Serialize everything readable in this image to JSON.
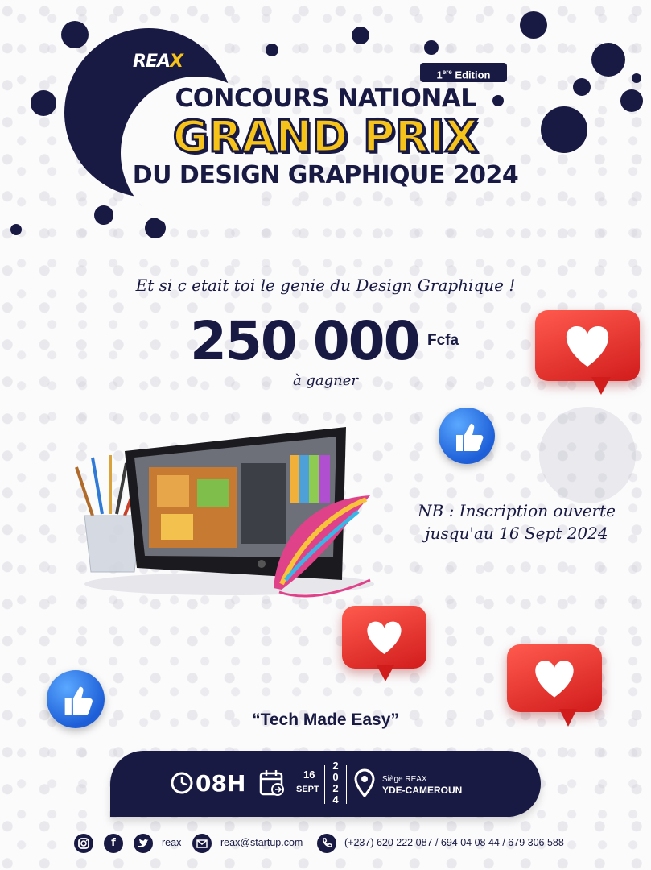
{
  "brand": {
    "logo_text": "REA",
    "logo_x": "X"
  },
  "header": {
    "edition_num": "1",
    "edition_sup": "ere",
    "edition_label": "Edition",
    "title_line1": "CONCOURS NATIONAL",
    "title_line2": "GRAND PRIX",
    "title_line3": "DU DESIGN GRAPHIQUE 2024"
  },
  "main": {
    "tagline": "Et si c etait toi le genie du Design Graphique !",
    "prize_amount": "250 000",
    "prize_currency": "Fcfa",
    "prize_sub": "à gagner",
    "nb_line1": "NB : Inscription ouverte",
    "nb_line2": "jusqu'au 16 Sept 2024",
    "motto": "“Tech Made Easy”"
  },
  "info_bar": {
    "time": "08H",
    "day": "16",
    "month": "SEPT",
    "year_digits": [
      "2",
      "0",
      "2",
      "4"
    ],
    "venue_name": "Siège REAX",
    "venue_city": "YDE-CAMEROUN"
  },
  "footer": {
    "social_handle": "reax",
    "email": "reax@startup.com",
    "phone": "(+237)  620 222 087 / 694  04 08 44 / 679 306 588"
  },
  "colors": {
    "navy": "#191a44",
    "yellow": "#f6c31b",
    "red": "#e02a24",
    "blue": "#1e5fd8"
  },
  "icons": [
    "clock-icon",
    "calendar-icon",
    "location-pin-icon",
    "instagram-icon",
    "facebook-icon",
    "twitter-icon",
    "mail-icon",
    "phone-icon",
    "thumbs-up-icon",
    "heart-icon"
  ]
}
